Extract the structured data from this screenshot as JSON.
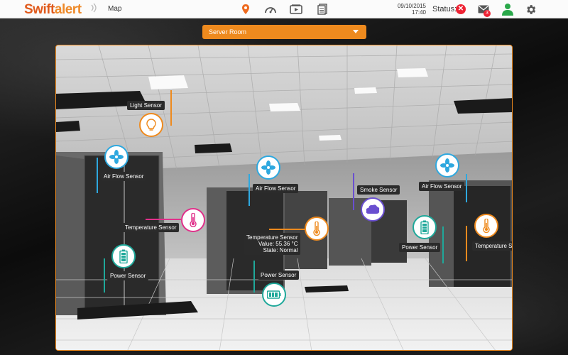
{
  "app": {
    "logo_part1": "Swift",
    "logo_part2": "alert",
    "page_title": "Map"
  },
  "header": {
    "nav_icons": [
      "map-pin-icon",
      "dashboard-gauge-icon",
      "video-icon",
      "document-icon"
    ],
    "date": "09/10/2015",
    "time": "17:40",
    "status_label": "Status:",
    "status_icon": "error-x-icon",
    "mail_badge": "3",
    "colors": {
      "brand_orange": "#ee8a1e",
      "status_red": "#e22233",
      "user_green": "#2aa84a"
    }
  },
  "room_select": {
    "value": "Server Room"
  },
  "sensors": {
    "light": {
      "label": "Light Sensor",
      "icon": "lightbulb-icon",
      "color": "#ee8a1e"
    },
    "airflow_left": {
      "label": "Air Flow Sensor",
      "icon": "fan-icon",
      "color": "#2ea8df"
    },
    "airflow_mid": {
      "label": "Air Flow Sensor",
      "icon": "fan-icon",
      "color": "#2ea8df"
    },
    "airflow_right": {
      "label": "Air Flow Sensor",
      "icon": "fan-icon",
      "color": "#2ea8df"
    },
    "temp_left": {
      "label": "Temperature Sensor",
      "icon": "thermometer-icon",
      "color": "#e0308a"
    },
    "temp_mid": {
      "label": "Temperature Sensor",
      "value_line": "Value: 55.36 °C",
      "state_line": "State: Normal",
      "icon": "thermometer-icon",
      "color": "#ee8a1e"
    },
    "temp_right": {
      "label": "Temperature Sensor",
      "icon": "thermometer-icon",
      "color": "#ee8a1e"
    },
    "smoke": {
      "label": "Smoke Sensor",
      "icon": "smoke-icon",
      "color": "#6a4fd0"
    },
    "power_left": {
      "label": "Power Sensor",
      "icon": "battery-icon",
      "color": "#1fa89a"
    },
    "power_mid": {
      "label": "Power Sensor",
      "icon": "battery-icon",
      "color": "#1fa89a"
    },
    "power_right": {
      "label": "Power Sensor",
      "icon": "battery-icon",
      "color": "#1fa89a"
    }
  }
}
